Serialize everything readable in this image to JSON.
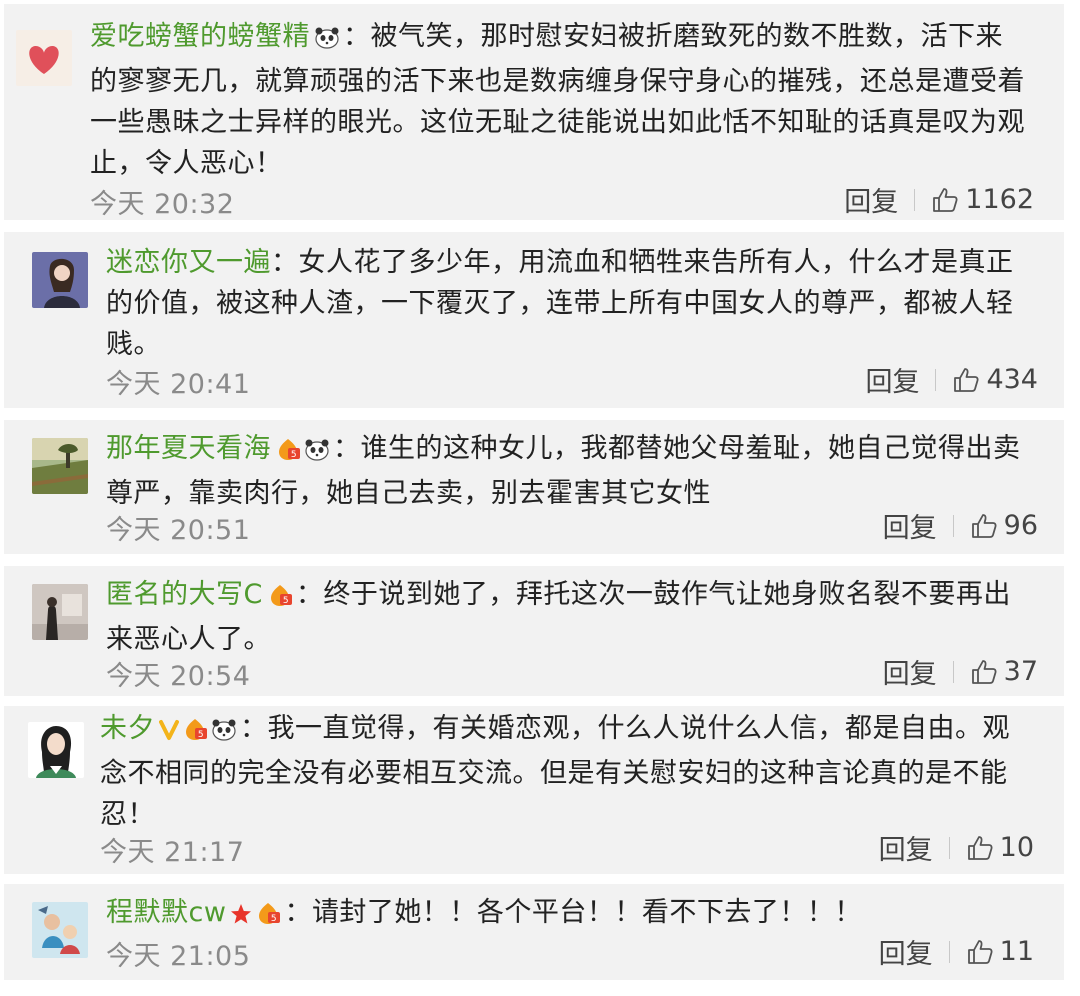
{
  "reply_label": "回复",
  "comments": [
    {
      "name": "爱吃螃蟹的螃蟹精",
      "badges": [
        "panda"
      ],
      "text": "被气笑，那时慰安妇被折磨致死的数不胜数，活下来的寥寥无几，就算顽强的活下来也是数病缠身保守身心的摧残，还总是遭受着一些愚昧之士异样的眼光。这位无耻之徒能说出如此恬不知耻的话真是叹为观止，令人恶心！",
      "time": "今天 20:32",
      "likes": "1162"
    },
    {
      "name": "迷恋你又一遍",
      "badges": [],
      "text": "女人花了多少年，用流血和牺牲来告所有人，什么才是真正的价值，被这种人渣，一下覆灭了，连带上所有中国女人的尊严，都被人轻贱。",
      "time": "今天 20:41",
      "likes": "434"
    },
    {
      "name": "那年夏天看海",
      "badges": [
        "level",
        "panda"
      ],
      "text": "谁生的这种女儿，我都替她父母羞耻，她自己觉得出卖尊严，靠卖肉行，她自己去卖，别去霍害其它女性",
      "time": "今天 20:51",
      "likes": "96"
    },
    {
      "name": "匿名的大写C",
      "badges": [
        "level"
      ],
      "text": "终于说到她了，拜托这次一鼓作气让她身败名裂不要再出来恶心人了。",
      "time": "今天 20:54",
      "likes": "37"
    },
    {
      "name": "未夕",
      "badges": [
        "vip",
        "level",
        "panda"
      ],
      "text": "我一直觉得，有关婚恋观，什么人说什么人信，都是自由。观念不相同的完全没有必要相互交流。但是有关慰安妇的这种言论真的是不能忍！",
      "time": "今天 21:17",
      "likes": "10"
    },
    {
      "name": "程默默cw",
      "badges": [
        "star",
        "level"
      ],
      "text": "请封了她！！各个平台！！看不下去了！！！",
      "time": "今天 21:05",
      "likes": "11"
    }
  ]
}
